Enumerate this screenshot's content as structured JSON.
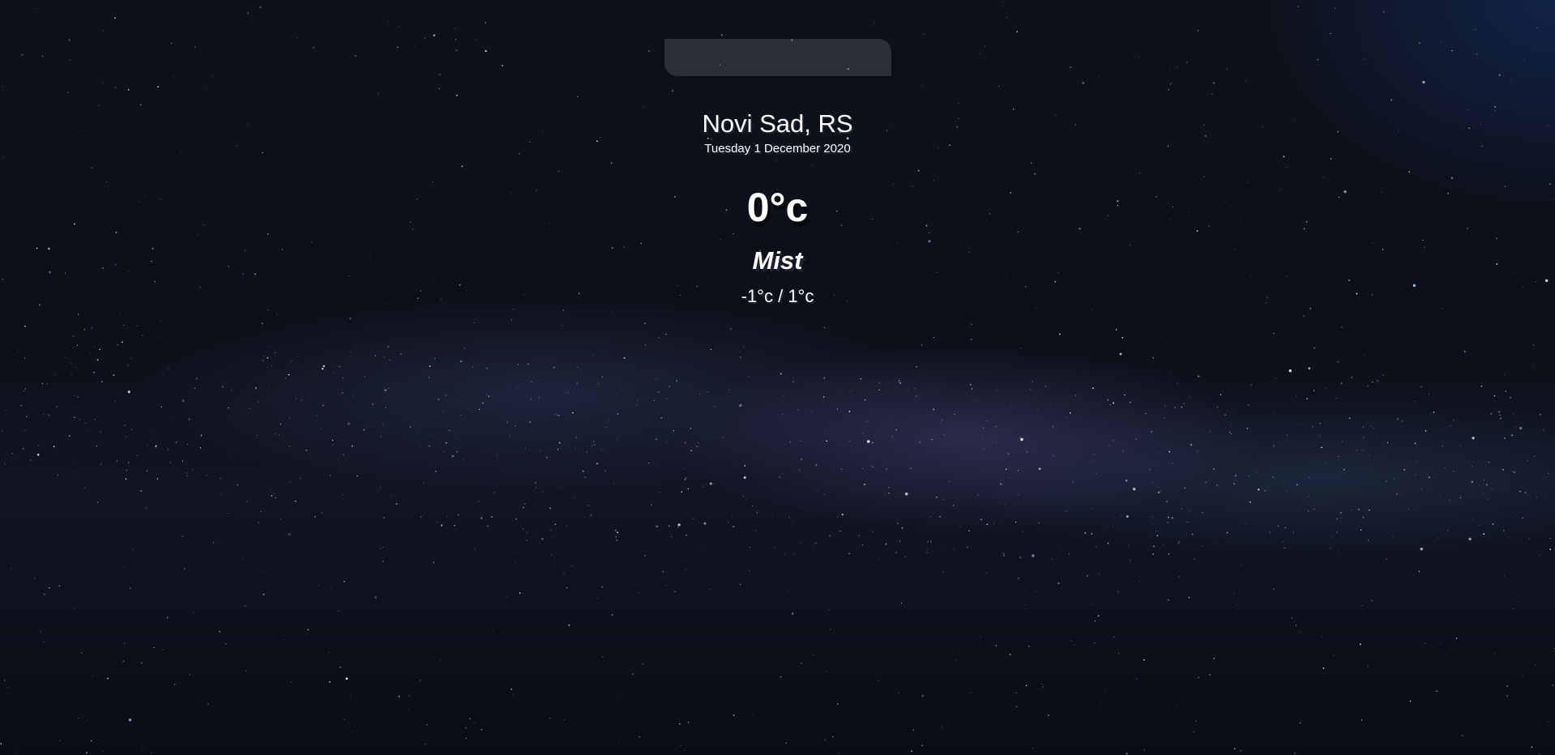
{
  "search": {
    "value": "",
    "placeholder": ""
  },
  "location": {
    "city": "Novi Sad, RS",
    "date": "Tuesday 1 December 2020"
  },
  "weather": {
    "temperature": "0°c",
    "condition": "Mist",
    "min_max": "-1°c / 1°c"
  },
  "colors": {
    "text": "#ffffff",
    "background": "#0e111a",
    "search_bg": "rgba(255,255,255,0.13)"
  }
}
